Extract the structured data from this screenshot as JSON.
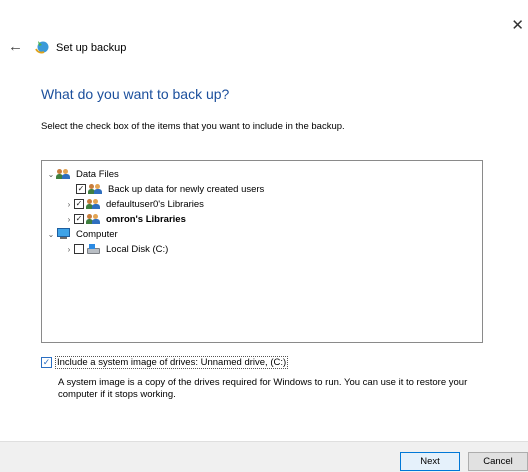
{
  "window": {
    "close_glyph": "✕"
  },
  "header": {
    "back_glyph": "←",
    "title": "Set up backup",
    "icon": "backup-icon"
  },
  "heading": "What do you want to back up?",
  "instruction": "Select the check box of the items that you want to include in the backup.",
  "tree": {
    "items": [
      {
        "label": "Data Files",
        "expanded": true,
        "checkbox": false,
        "icon": "users-icon"
      },
      {
        "label": "Back up data for newly created users",
        "checked": true,
        "icon": "users-icon"
      },
      {
        "label": "defaultuser0's Libraries",
        "checked": true,
        "expanded": false,
        "icon": "users-icon"
      },
      {
        "label": "omron's Libraries",
        "checked": true,
        "expanded": false,
        "icon": "users-icon",
        "bold": true
      },
      {
        "label": "Computer",
        "expanded": true,
        "checkbox": false,
        "icon": "computer-icon"
      },
      {
        "label": "Local Disk (C:)",
        "checked": false,
        "expanded": false,
        "icon": "disk-icon"
      }
    ],
    "glyphs": {
      "expanded": "⌄",
      "collapsed": "›",
      "check": "✓"
    }
  },
  "system_image": {
    "checked": true,
    "label": "Include a system image of drives: Unnamed drive, (C:)",
    "description": "A system image is a copy of the drives required for Windows to run. You can use it to restore your computer if it stops working."
  },
  "buttons": {
    "next": "Next",
    "cancel": "Cancel"
  }
}
